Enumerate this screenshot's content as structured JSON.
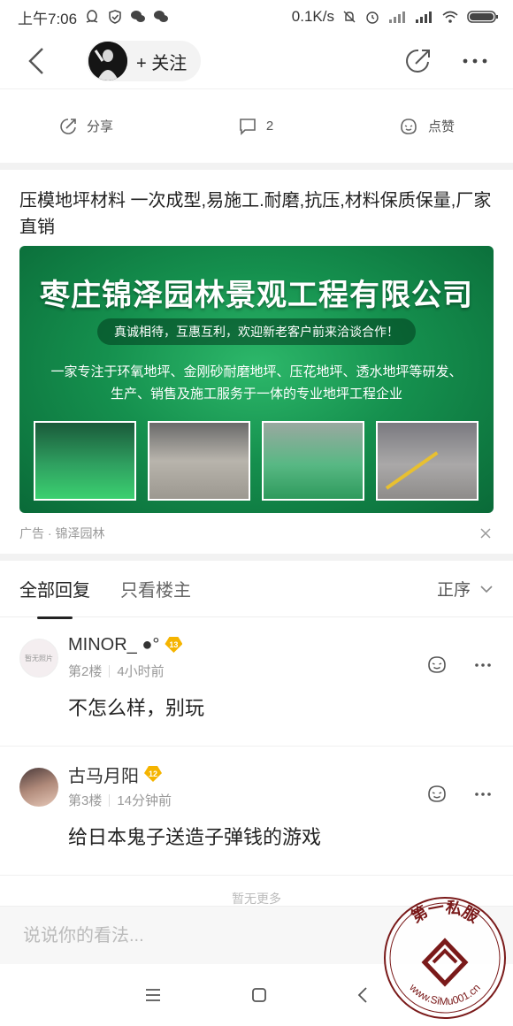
{
  "status_bar": {
    "time": "上午7:06",
    "speed": "0.1K/s"
  },
  "nav": {
    "follow_label": "+ 关注"
  },
  "actions": {
    "share_label": "分享",
    "comment_count": "2",
    "like_label": "点赞"
  },
  "ad": {
    "title": "压模地坪材料 一次成型,易施工.耐磨,抗压,材料保质保量,厂家直销",
    "company": "枣庄锦泽园林景观工程有限公司",
    "slogan": "真诚相待，互惠互利，欢迎新老客户前来洽谈合作！",
    "desc_line1": "一家专注于环氧地坪、金刚砂耐磨地坪、压花地坪、透水地坪等研发、",
    "desc_line2": "生产、销售及施工服务于一体的专业地坪工程企业",
    "source": "广告 · 锦泽园林"
  },
  "tabs": {
    "all": "全部回复",
    "owner_only": "只看楼主",
    "sort": "正序"
  },
  "comments": [
    {
      "name": "MINOR_ ●°",
      "level": "13",
      "floor": "第2楼",
      "time": "4小时前",
      "text": "不怎么样，别玩",
      "avatar_text": "暂无照片"
    },
    {
      "name": "古马月阳",
      "level": "12",
      "floor": "第3楼",
      "time": "14分钟前",
      "text": "给日本鬼子送造子弹钱的游戏"
    }
  ],
  "no_more": "暂无更多",
  "input": {
    "placeholder": "说说你的看法..."
  },
  "watermark": {
    "text": "第一私服",
    "url": "www.SiMu001.cn"
  },
  "colors": {
    "accent_green": "#15904e",
    "level_badge": "#f5b400"
  }
}
